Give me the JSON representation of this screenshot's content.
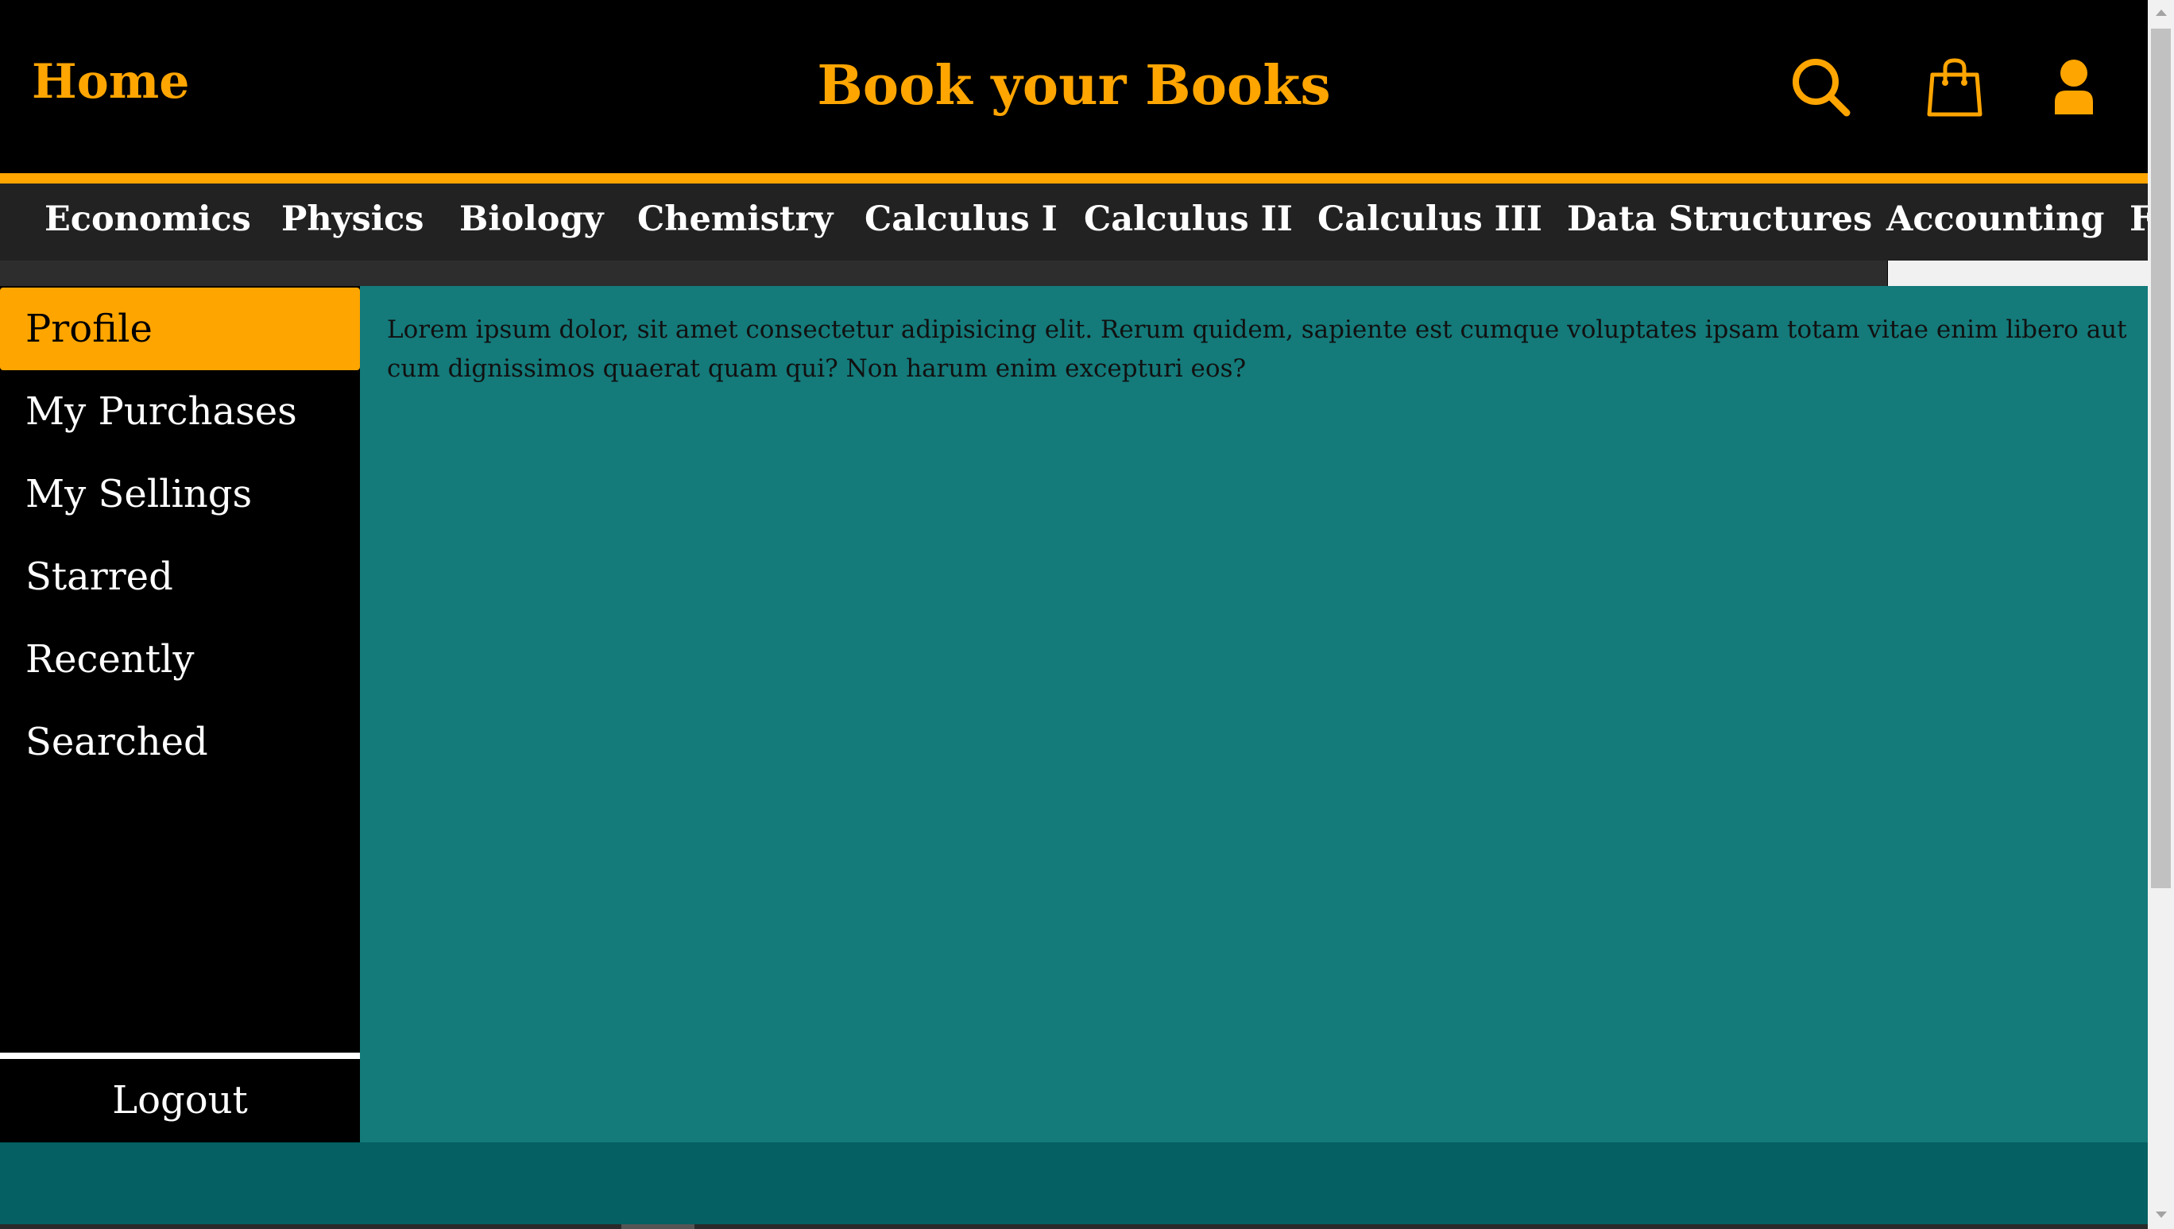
{
  "header": {
    "home_label": "Home",
    "title": "Book your Books",
    "icons": [
      "search-icon",
      "shopping-bag-icon",
      "user-icon"
    ]
  },
  "categories": [
    "Economics",
    "Physics",
    "Biology",
    "Chemistry",
    "Calculus I",
    "Calculus II",
    "Calculus III",
    "Data Structures",
    "Accounting",
    "F"
  ],
  "sidebar": {
    "items": [
      {
        "label": "Profile",
        "active": true
      },
      {
        "label": "My Purchases",
        "active": false
      },
      {
        "label": "My Sellings",
        "active": false
      },
      {
        "label": "Starred",
        "active": false
      },
      {
        "label": "Recently Searched",
        "active": false
      }
    ],
    "logout_label": "Logout"
  },
  "main": {
    "text": "Lorem ipsum dolor, sit amet consectetur adipisicing elit. Rerum quidem, sapiente est cumque voluptates ipsam totam vitae enim libero aut cum dignissimos quaerat quam qui? Non harum enim excepturi eos?"
  },
  "colors": {
    "accent": "#ffa500",
    "content_bg": "#147a7a",
    "footer_bg": "#046062",
    "nav_bg": "#222222",
    "header_bg": "#000000"
  }
}
